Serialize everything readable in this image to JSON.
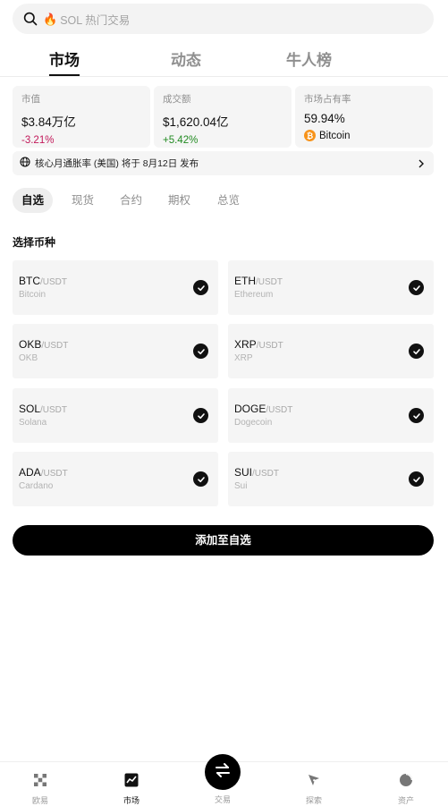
{
  "search": {
    "fire_icon": "fire-emoji",
    "placeholder": "SOL 热门交易"
  },
  "tabs": [
    "市场",
    "动态",
    "牛人榜"
  ],
  "stats": [
    {
      "label": "市值",
      "value": "$3.84万亿",
      "change": "-3.21%",
      "trend": "down"
    },
    {
      "label": "成交额",
      "value": "$1,620.04亿",
      "change": "+5.42%",
      "trend": "up"
    },
    {
      "label": "市场占有率",
      "value": "59.94%",
      "coin": "Bitcoin",
      "coin_symbol": "₿"
    }
  ],
  "notice": {
    "text": "核心月通胀率 (美国) 将于 8月12日 发布"
  },
  "subtabs": [
    "自选",
    "现货",
    "合约",
    "期权",
    "总览"
  ],
  "section_title": "选择币种",
  "coins": [
    {
      "base": "BTC",
      "quote": "/USDT",
      "name": "Bitcoin"
    },
    {
      "base": "ETH",
      "quote": "/USDT",
      "name": "Ethereum"
    },
    {
      "base": "OKB",
      "quote": "/USDT",
      "name": "OKB"
    },
    {
      "base": "XRP",
      "quote": "/USDT",
      "name": "XRP"
    },
    {
      "base": "SOL",
      "quote": "/USDT",
      "name": "Solana"
    },
    {
      "base": "DOGE",
      "quote": "/USDT",
      "name": "Dogecoin"
    },
    {
      "base": "ADA",
      "quote": "/USDT",
      "name": "Cardano"
    },
    {
      "base": "SUI",
      "quote": "/USDT",
      "name": "Sui"
    }
  ],
  "add_button": "添加至自选",
  "nav": [
    "欧易",
    "市场",
    "交易",
    "探索",
    "资产"
  ],
  "colors": {
    "accent": "#000000",
    "down": "#c2195a",
    "up": "#228b22",
    "btc": "#f7931a"
  }
}
